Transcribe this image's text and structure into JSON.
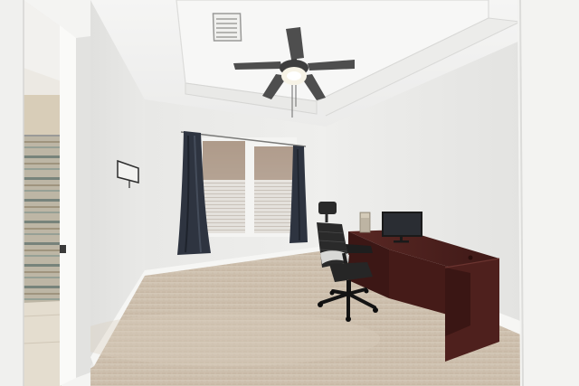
{
  "scene": {
    "subject": "home-office-room",
    "palette": {
      "ceiling": "#f2f2f1",
      "wall_left": "#e6e6e4",
      "wall_back": "#eeeeec",
      "wall_right": "#ebebe9",
      "carpet": "#cdbfae",
      "curtain": "#2e3440",
      "desk": "#4a1f1c",
      "chair": "#2a2a2a",
      "doorframe": "#f4f4f2",
      "tile": "#d8cdb8",
      "shower_curtain": "#b8b2a2"
    },
    "objects": [
      "ceiling-fan",
      "ceiling-vent",
      "tray-ceiling",
      "window",
      "curtains",
      "desk",
      "monitor",
      "office-chair",
      "wall-hook",
      "doorway",
      "bathroom",
      "carpet"
    ]
  }
}
